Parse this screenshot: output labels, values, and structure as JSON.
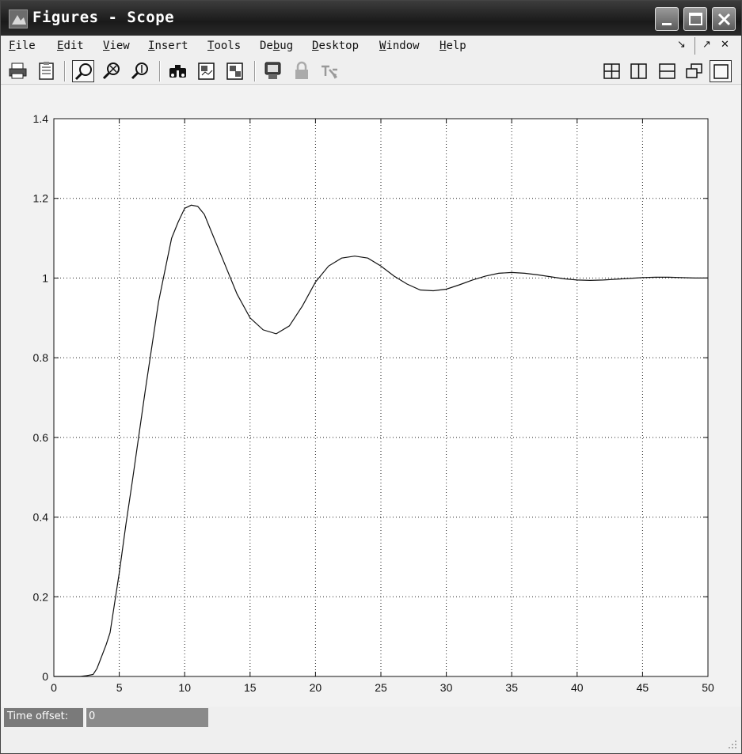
{
  "window": {
    "title": "Figures - Scope"
  },
  "menu": [
    {
      "label": "File",
      "u": "F",
      "rest": "ile"
    },
    {
      "label": "Edit",
      "u": "E",
      "rest": "dit"
    },
    {
      "label": "View",
      "u": "V",
      "rest": "iew"
    },
    {
      "label": "Insert",
      "u": "I",
      "rest": "nsert"
    },
    {
      "label": "Tools",
      "u": "T",
      "rest": "ools"
    },
    {
      "label": "Debug",
      "pre": "De",
      "u": "b",
      "rest": "ug"
    },
    {
      "label": "Desktop",
      "u": "D",
      "rest": "esktop"
    },
    {
      "label": "Window",
      "u": "W",
      "rest": "indow"
    },
    {
      "label": "Help",
      "u": "H",
      "rest": "elp"
    }
  ],
  "menu_right": {
    "dock_glyph": "↘",
    "undock_glyph": "↗",
    "close_glyph": "✕"
  },
  "toolbar": {
    "icons": [
      "print-icon",
      "print-preview-icon",
      "zoom-in-icon",
      "zoom-out-icon",
      "restore-zoom-icon",
      "find-icon",
      "scope-params-icon",
      "signal-select-icon",
      "float-scope-icon",
      "lock-axes-icon",
      "signal-selector-icon",
      "tile-all-icon",
      "tile-left-right-icon",
      "tile-top-bottom-icon",
      "float-icon",
      "maximize-icon"
    ]
  },
  "status": {
    "time_offset_label": "Time offset:",
    "time_offset_value": "0"
  },
  "chart_data": {
    "type": "line",
    "title": "",
    "xlabel": "",
    "ylabel": "",
    "xlim": [
      0,
      50
    ],
    "ylim": [
      0,
      1.4
    ],
    "xticks": [
      "0",
      "5",
      "10",
      "15",
      "20",
      "25",
      "30",
      "35",
      "40",
      "45",
      "50"
    ],
    "yticks": [
      "0",
      "0.2",
      "0.4",
      "0.6",
      "0.8",
      "1",
      "1.2",
      "1.4"
    ],
    "grid": true,
    "series": [
      {
        "x": [
          0,
          2,
          2.5,
          3,
          3.3,
          4,
          4.3,
          5,
          5.5,
          6,
          7,
          8,
          8.5,
          9,
          9.5,
          10,
          10.5,
          11,
          11.5,
          12,
          13,
          14,
          15,
          16,
          17,
          18,
          19,
          20,
          21,
          22,
          23,
          24,
          25,
          26,
          27,
          28,
          29,
          30,
          31,
          32,
          33,
          34,
          35,
          36,
          37,
          38,
          39,
          40,
          41,
          42,
          43,
          44,
          45,
          46,
          47,
          48,
          49,
          50
        ],
        "y": [
          0,
          0,
          0.002,
          0.005,
          0.02,
          0.08,
          0.11,
          0.26,
          0.38,
          0.49,
          0.72,
          0.94,
          1.02,
          1.1,
          1.14,
          1.175,
          1.183,
          1.18,
          1.16,
          1.12,
          1.04,
          0.96,
          0.9,
          0.87,
          0.86,
          0.88,
          0.93,
          0.99,
          1.03,
          1.05,
          1.055,
          1.05,
          1.03,
          1.005,
          0.985,
          0.97,
          0.968,
          0.972,
          0.983,
          0.995,
          1.005,
          1.012,
          1.014,
          1.012,
          1.008,
          1.003,
          0.998,
          0.995,
          0.994,
          0.995,
          0.997,
          0.999,
          1.001,
          1.002,
          1.002,
          1.001,
          1.0,
          1.0
        ]
      }
    ]
  }
}
